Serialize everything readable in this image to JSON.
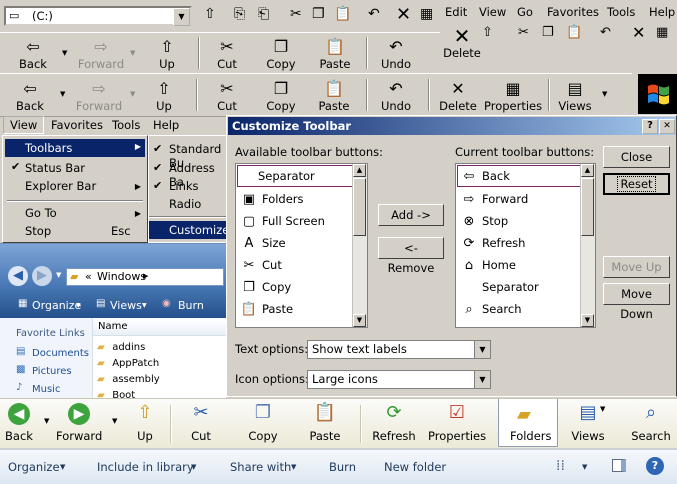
{
  "address": {
    "value": "(C:)"
  },
  "menu_top": [
    "Edit",
    "View",
    "Go",
    "Favorites",
    "Tools",
    "Help"
  ],
  "toolbar_win2k": {
    "back": "Back",
    "forward": "Forward",
    "up": "Up",
    "cut": "Cut",
    "copy": "Copy",
    "paste": "Paste",
    "undo": "Undo",
    "delete": "Delete"
  },
  "toolbar_winme": {
    "back": "Back",
    "forward": "Forward",
    "up": "Up",
    "cut": "Cut",
    "copy": "Copy",
    "paste": "Paste",
    "undo": "Undo",
    "delete": "Delete",
    "properties": "Properties",
    "views": "Views"
  },
  "menubar": [
    "View",
    "Favorites",
    "Tools",
    "Help"
  ],
  "view_menu": {
    "toolbars": "Toolbars",
    "status_bar": "Status Bar",
    "explorer_bar": "Explorer Bar",
    "go_to": "Go To",
    "stop": "Stop",
    "stop_shortcut": "Esc"
  },
  "toolbars_submenu": [
    "Standard Bu",
    "Address Ba",
    "Links",
    "Radio",
    "Customize..."
  ],
  "dialog": {
    "title": "Customize Toolbar",
    "available_label": "Available toolbar buttons:",
    "current_label": "Current toolbar buttons:",
    "available": [
      "Separator",
      "Folders",
      "Full Screen",
      "Size",
      "Cut",
      "Copy",
      "Paste"
    ],
    "current": [
      "Back",
      "Forward",
      "Stop",
      "Refresh",
      "Home",
      "Separator",
      "Search"
    ],
    "add": "Add ->",
    "remove": "<- Remove",
    "close": "Close",
    "reset": "Reset",
    "move_up": "Move Up",
    "move_down": "Move Down",
    "text_options_label": "Text options:",
    "text_options_value": "Show text labels",
    "icon_options_label": "Icon options:",
    "icon_options_value": "Large icons",
    "help_btn": "?",
    "close_btn": "✕"
  },
  "vista": {
    "path_sep": "«",
    "path": "Windows",
    "organize": "Organize",
    "views": "Views",
    "burn": "Burn",
    "favorite_links": "Favorite Links",
    "links": [
      "Documents",
      "Pictures",
      "Music"
    ],
    "name_header": "Name",
    "files": [
      "addins",
      "AppPatch",
      "assembly",
      "Boot"
    ]
  },
  "toolbar_xp": {
    "back": "Back",
    "forward": "Forward",
    "up": "Up",
    "cut": "Cut",
    "copy": "Copy",
    "paste": "Paste",
    "refresh": "Refresh",
    "properties": "Properties",
    "folders": "Folders",
    "views": "Views",
    "search": "Search"
  },
  "bar7": {
    "organize": "Organize",
    "include": "Include in library",
    "share": "Share with",
    "burn": "Burn",
    "new_folder": "New folder"
  }
}
